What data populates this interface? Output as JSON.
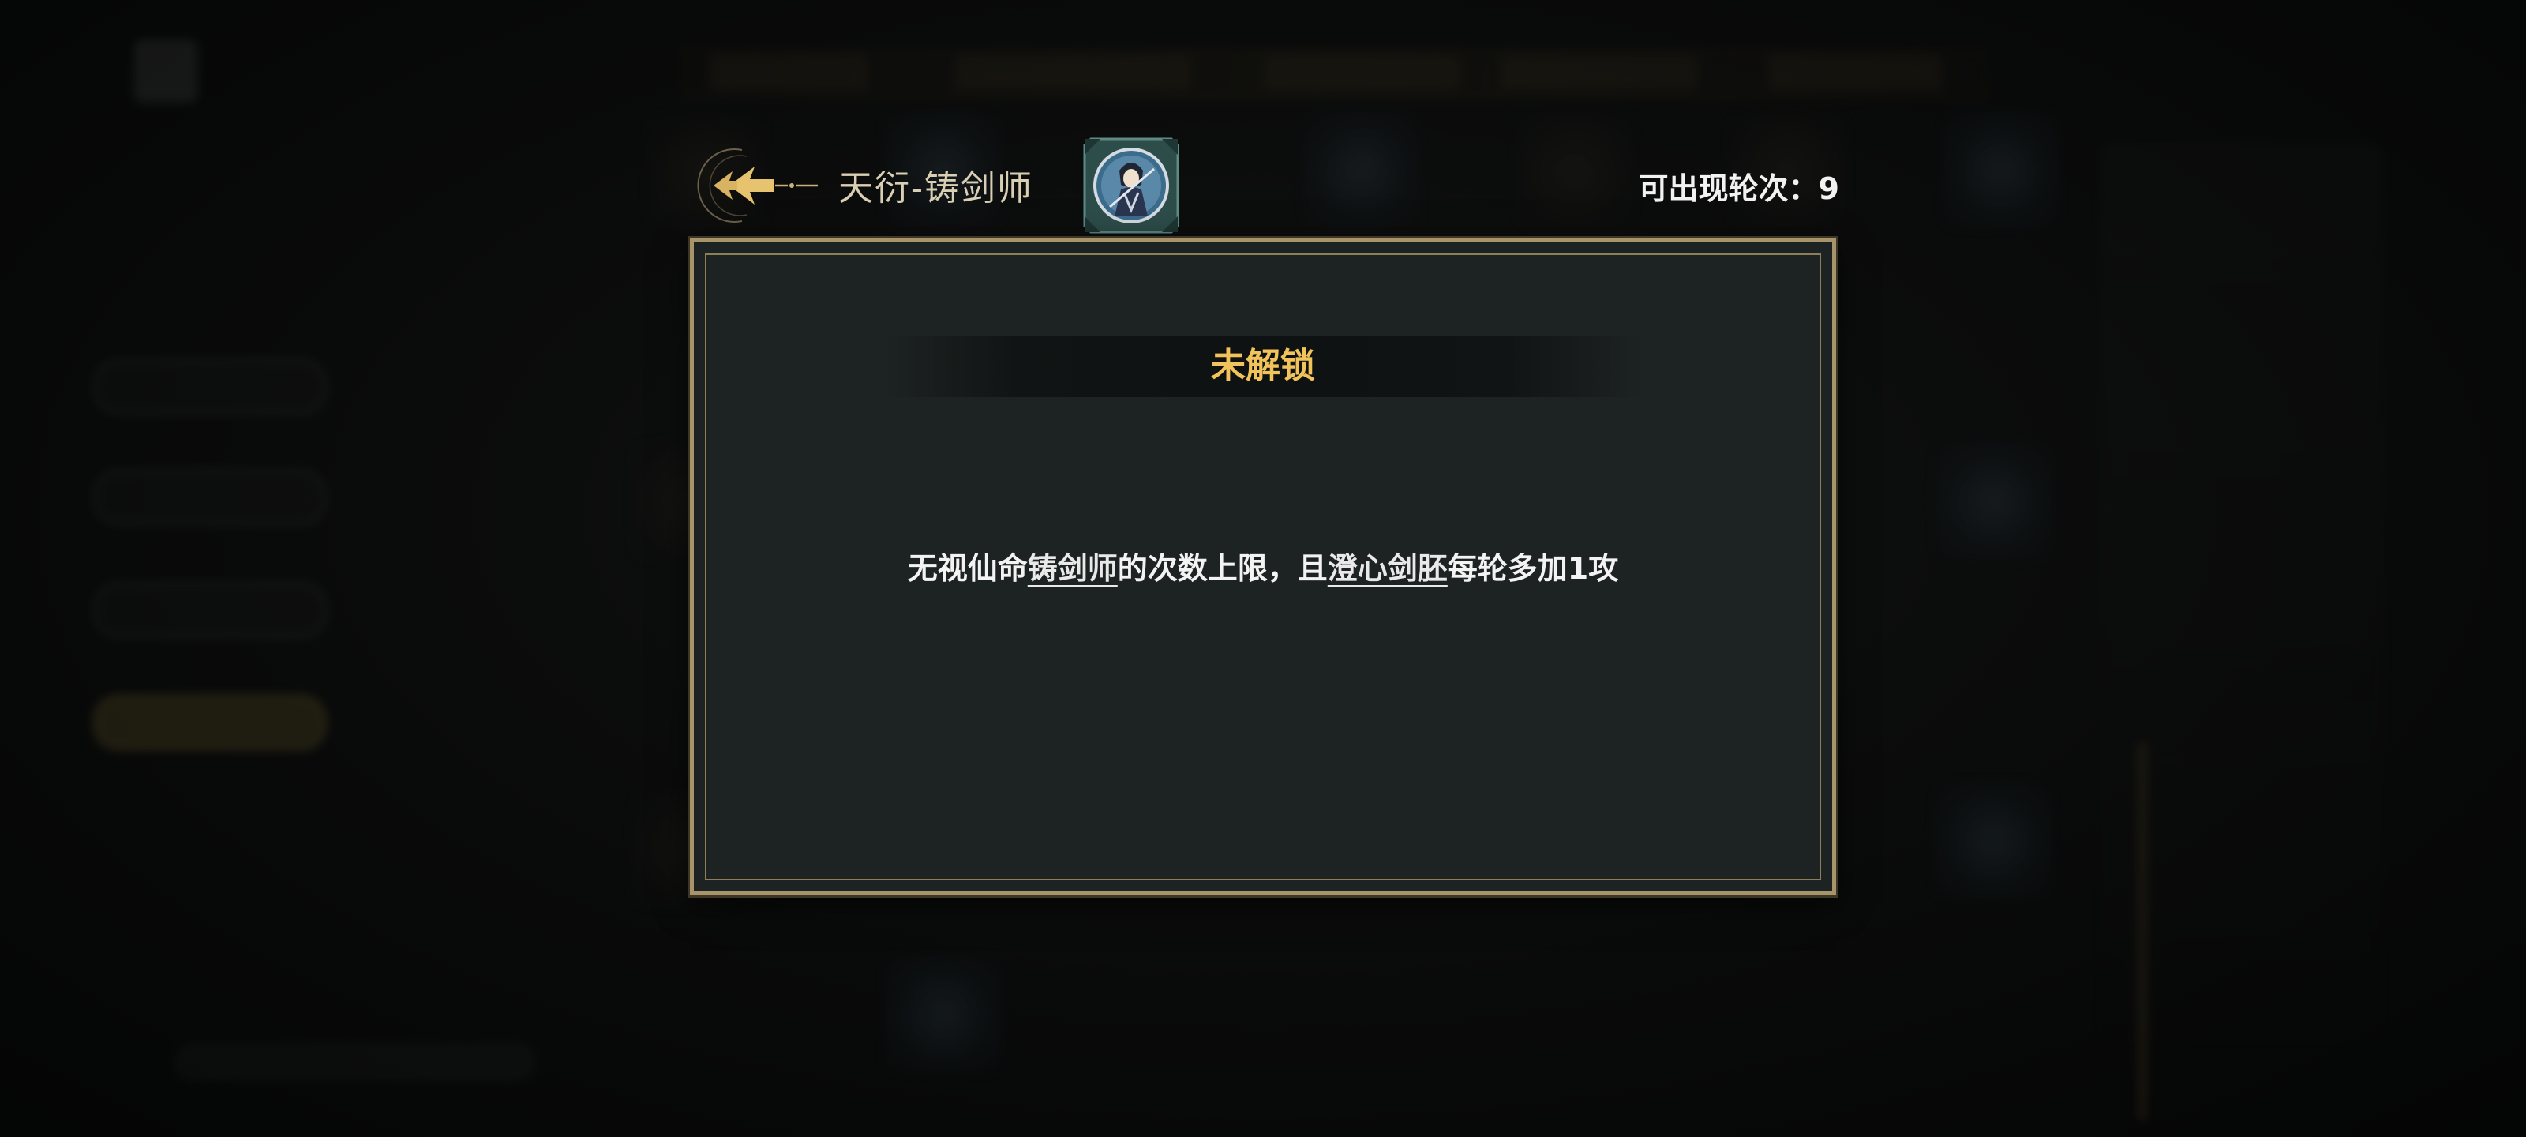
{
  "header": {
    "title": "天衍-铸剑师",
    "rounds_label": "可出现轮次：",
    "rounds_value": "9"
  },
  "dialog": {
    "status": "未解锁",
    "description": {
      "part1": "无视仙命",
      "keyword1": "铸剑师",
      "part2": "的次数上限，且",
      "keyword2": "澄心剑胚",
      "part3": "每轮多加1攻"
    }
  },
  "icons": {
    "back": "arrow-back-icon",
    "portrait": "swordsmith-portrait-icon"
  },
  "colors": {
    "status_gold": "#f1c35a",
    "frame_gold": "#a7946a",
    "panel_bg": "#1d2322",
    "title_text": "#d9cfb4"
  }
}
